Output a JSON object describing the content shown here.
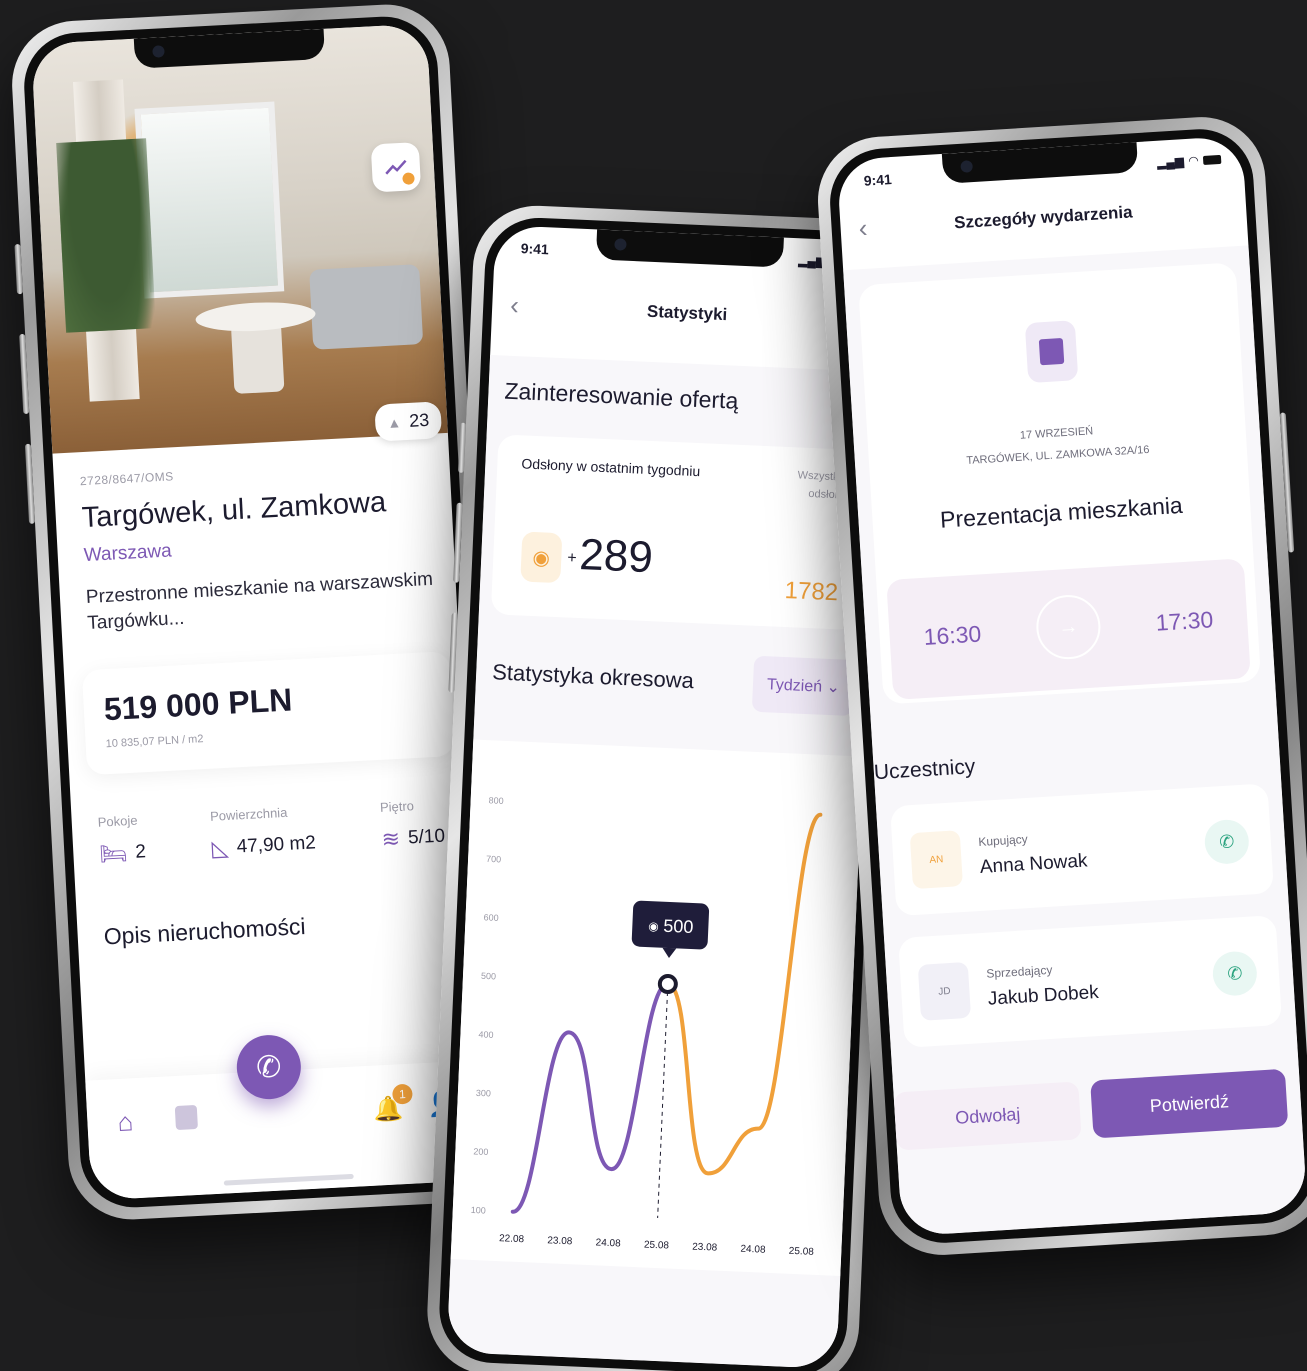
{
  "colors": {
    "accent": "#7d58b4",
    "orange": "#f0a03a",
    "green": "#2ba37f",
    "bg": "#1e1e1f"
  },
  "phone1": {
    "photo_count": "23",
    "ref": "2728/8647/OMS",
    "title": "Targówek, ul. Zamkowa",
    "city": "Warszawa",
    "description": "Przestronne mieszkanie na warszawskim Targówku...",
    "price": "519 000 PLN",
    "price_per_m2": "10 835,07 PLN / m2",
    "props": [
      {
        "label": "Pokoje",
        "value": "2",
        "icon": "bed-icon"
      },
      {
        "label": "Powierzchnia",
        "value": "47,90 m2",
        "icon": "ruler-icon"
      },
      {
        "label": "Piętro",
        "value": "5/10",
        "icon": "layers-icon"
      }
    ],
    "section_title": "Opis nieruchomości",
    "notif_count": "1"
  },
  "phone2": {
    "time": "9:41",
    "title": "Statystyki",
    "heading": "Zainteresowanie ofertą",
    "views_label": "Odsłony w ostatnim tygodniu",
    "views_all_label": "Wszystkie odsłony",
    "plus": "+",
    "views_week": "289",
    "views_all": "1782",
    "period_heading": "Statystyka okresowa",
    "period_select": "Tydzień",
    "tooltip": "500"
  },
  "chart_data": {
    "type": "line",
    "x": [
      "22.08",
      "23.08",
      "24.08",
      "25.08",
      "23.08",
      "24.08",
      "25.08"
    ],
    "yticks": [
      100,
      200,
      300,
      400,
      500,
      600,
      700,
      800
    ],
    "ylim": [
      100,
      800
    ],
    "series": [
      {
        "values": [
          100,
          410,
          180,
          500,
          null,
          null,
          null
        ]
      },
      {
        "values": [
          null,
          null,
          null,
          500,
          180,
          260,
          800
        ]
      }
    ],
    "highlight": {
      "x": "25.08",
      "value": 500
    }
  },
  "phone3": {
    "time": "9:41",
    "title": "Szczegóły wydarzenia",
    "date": "17 WRZESIEŃ",
    "address": "TARGÓWEK, UL. ZAMKOWA 32A/16",
    "event_title": "Prezentacja mieszkania",
    "time_start": "16:30",
    "time_end": "17:30",
    "participants_heading": "Uczestnicy",
    "participants": [
      {
        "initials": "AN",
        "role": "Kupujący",
        "name": "Anna Nowak"
      },
      {
        "initials": "JD",
        "role": "Sprzedający",
        "name": "Jakub Dobek"
      }
    ],
    "cancel": "Odwołaj",
    "confirm": "Potwierdź"
  }
}
